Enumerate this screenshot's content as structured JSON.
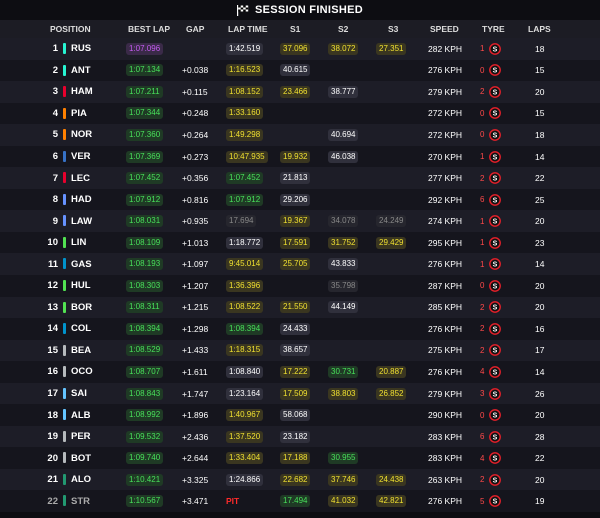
{
  "title": "SESSION FINISHED",
  "headers": {
    "position": "POSITION",
    "best_lap": "BEST LAP",
    "gap": "GAP",
    "lap_time": "LAP TIME",
    "s1": "S1",
    "s2": "S2",
    "s3": "S3",
    "speed": "SPEED",
    "tyre": "TYRE",
    "laps": "LAPS"
  },
  "colors": {
    "purple": "#c45cf0",
    "green": "#48e05a",
    "yellow": "#f0e030",
    "red": "#ff2a2a"
  },
  "rows": [
    {
      "pos": "1",
      "code": "RUS",
      "team_color": "#27f4d2",
      "best": "1:07.096",
      "best_c": "purple",
      "gap": "",
      "lap": "1:42.519",
      "lap_c": "white",
      "s1": "37.096",
      "s1_c": "yellow",
      "s2": "38.072",
      "s2_c": "yellow",
      "s3": "27.351",
      "s3_c": "yellow",
      "speed": "282 KPH",
      "tyre_laps": "1",
      "laps": "18"
    },
    {
      "pos": "2",
      "code": "ANT",
      "team_color": "#27f4d2",
      "best": "1:07.134",
      "best_c": "green",
      "gap": "+0.038",
      "lap": "1:16.523",
      "lap_c": "yellow",
      "s1": "40.615",
      "s1_c": "white",
      "s2": "",
      "s2_c": "none",
      "s3": "",
      "s3_c": "none",
      "speed": "276 KPH",
      "tyre_laps": "0",
      "laps": "15"
    },
    {
      "pos": "3",
      "code": "HAM",
      "team_color": "#e8002d",
      "best": "1:07.211",
      "best_c": "green",
      "gap": "+0.115",
      "lap": "1:08.152",
      "lap_c": "yellow",
      "s1": "23.466",
      "s1_c": "yellow",
      "s2": "38.777",
      "s2_c": "white",
      "s3": "",
      "s3_c": "none",
      "speed": "279 KPH",
      "tyre_laps": "2",
      "laps": "20"
    },
    {
      "pos": "4",
      "code": "PIA",
      "team_color": "#ff8000",
      "best": "1:07.344",
      "best_c": "green",
      "gap": "+0.248",
      "lap": "1:33.160",
      "lap_c": "yellow",
      "s1": "",
      "s1_c": "none",
      "s2": "",
      "s2_c": "none",
      "s3": "",
      "s3_c": "none",
      "speed": "272 KPH",
      "tyre_laps": "0",
      "laps": "15"
    },
    {
      "pos": "5",
      "code": "NOR",
      "team_color": "#ff8000",
      "best": "1:07.360",
      "best_c": "green",
      "gap": "+0.264",
      "lap": "1:49.298",
      "lap_c": "yellow",
      "s1": "",
      "s1_c": "none",
      "s2": "40.694",
      "s2_c": "white",
      "s3": "",
      "s3_c": "none",
      "speed": "272 KPH",
      "tyre_laps": "0",
      "laps": "18"
    },
    {
      "pos": "6",
      "code": "VER",
      "team_color": "#3671c6",
      "best": "1:07.369",
      "best_c": "green",
      "gap": "+0.273",
      "lap": "10:47.935",
      "lap_c": "yellow",
      "s1": "19.932",
      "s1_c": "yellow",
      "s2": "46.038",
      "s2_c": "white",
      "s3": "",
      "s3_c": "none",
      "speed": "270 KPH",
      "tyre_laps": "1",
      "laps": "14"
    },
    {
      "pos": "7",
      "code": "LEC",
      "team_color": "#e8002d",
      "best": "1:07.452",
      "best_c": "green",
      "gap": "+0.356",
      "lap": "1:07.452",
      "lap_c": "green",
      "s1": "21.813",
      "s1_c": "white",
      "s2": "",
      "s2_c": "none",
      "s3": "",
      "s3_c": "none",
      "speed": "277 KPH",
      "tyre_laps": "2",
      "laps": "22"
    },
    {
      "pos": "8",
      "code": "HAD",
      "team_color": "#6692ff",
      "best": "1:07.912",
      "best_c": "green",
      "gap": "+0.816",
      "lap": "1:07.912",
      "lap_c": "green",
      "s1": "29.206",
      "s1_c": "white",
      "s2": "",
      "s2_c": "none",
      "s3": "",
      "s3_c": "none",
      "speed": "292 KPH",
      "tyre_laps": "6",
      "laps": "25"
    },
    {
      "pos": "9",
      "code": "LAW",
      "team_color": "#6692ff",
      "best": "1:08.031",
      "best_c": "green",
      "gap": "+0.935",
      "lap": "17.694",
      "lap_c": "grey",
      "s1": "19.367",
      "s1_c": "yellow",
      "s2": "34.078",
      "s2_c": "grey",
      "s3": "24.249",
      "s3_c": "grey",
      "speed": "274 KPH",
      "tyre_laps": "1",
      "laps": "20"
    },
    {
      "pos": "10",
      "code": "LIN",
      "team_color": "#52e252",
      "best": "1:08.109",
      "best_c": "green",
      "gap": "+1.013",
      "lap": "1:18.772",
      "lap_c": "white",
      "s1": "17.591",
      "s1_c": "yellow",
      "s2": "31.752",
      "s2_c": "yellow",
      "s3": "29.429",
      "s3_c": "yellow",
      "speed": "295 KPH",
      "tyre_laps": "1",
      "laps": "23"
    },
    {
      "pos": "11",
      "code": "GAS",
      "team_color": "#0093cc",
      "best": "1:08.193",
      "best_c": "green",
      "gap": "+1.097",
      "lap": "9:45.014",
      "lap_c": "yellow",
      "s1": "25.705",
      "s1_c": "yellow",
      "s2": "43.833",
      "s2_c": "white",
      "s3": "",
      "s3_c": "none",
      "speed": "276 KPH",
      "tyre_laps": "1",
      "laps": "14"
    },
    {
      "pos": "12",
      "code": "HUL",
      "team_color": "#52e252",
      "best": "1:08.303",
      "best_c": "green",
      "gap": "+1.207",
      "lap": "1:36.396",
      "lap_c": "yellow",
      "s1": "",
      "s1_c": "none",
      "s2": "35.798",
      "s2_c": "grey",
      "s3": "",
      "s3_c": "none",
      "speed": "287 KPH",
      "tyre_laps": "0",
      "laps": "20"
    },
    {
      "pos": "13",
      "code": "BOR",
      "team_color": "#52e252",
      "best": "1:08.311",
      "best_c": "green",
      "gap": "+1.215",
      "lap": "1:08.522",
      "lap_c": "yellow",
      "s1": "21.550",
      "s1_c": "yellow",
      "s2": "44.149",
      "s2_c": "white",
      "s3": "",
      "s3_c": "none",
      "speed": "285 KPH",
      "tyre_laps": "2",
      "laps": "20"
    },
    {
      "pos": "14",
      "code": "COL",
      "team_color": "#0093cc",
      "best": "1:08.394",
      "best_c": "green",
      "gap": "+1.298",
      "lap": "1:08.394",
      "lap_c": "green",
      "s1": "24.433",
      "s1_c": "white",
      "s2": "",
      "s2_c": "none",
      "s3": "",
      "s3_c": "none",
      "speed": "276 KPH",
      "tyre_laps": "2",
      "laps": "16"
    },
    {
      "pos": "15",
      "code": "BEA",
      "team_color": "#b6babd",
      "best": "1:08.529",
      "best_c": "green",
      "gap": "+1.433",
      "lap": "1:18.315",
      "lap_c": "yellow",
      "s1": "38.657",
      "s1_c": "white",
      "s2": "",
      "s2_c": "none",
      "s3": "",
      "s3_c": "none",
      "speed": "275 KPH",
      "tyre_laps": "2",
      "laps": "17"
    },
    {
      "pos": "16",
      "code": "OCO",
      "team_color": "#b6babd",
      "best": "1:08.707",
      "best_c": "green",
      "gap": "+1.611",
      "lap": "1:08.840",
      "lap_c": "white",
      "s1": "17.222",
      "s1_c": "yellow",
      "s2": "30.731",
      "s2_c": "green",
      "s3": "20.887",
      "s3_c": "yellow",
      "speed": "276 KPH",
      "tyre_laps": "4",
      "laps": "14"
    },
    {
      "pos": "17",
      "code": "SAI",
      "team_color": "#64c4ff",
      "best": "1:08.843",
      "best_c": "green",
      "gap": "+1.747",
      "lap": "1:23.164",
      "lap_c": "white",
      "s1": "17.509",
      "s1_c": "yellow",
      "s2": "38.803",
      "s2_c": "yellow",
      "s3": "26.852",
      "s3_c": "yellow",
      "speed": "279 KPH",
      "tyre_laps": "3",
      "laps": "26"
    },
    {
      "pos": "18",
      "code": "ALB",
      "team_color": "#64c4ff",
      "best": "1:08.992",
      "best_c": "green",
      "gap": "+1.896",
      "lap": "1:40.967",
      "lap_c": "yellow",
      "s1": "58.068",
      "s1_c": "white",
      "s2": "",
      "s2_c": "none",
      "s3": "",
      "s3_c": "none",
      "speed": "290 KPH",
      "tyre_laps": "0",
      "laps": "20"
    },
    {
      "pos": "19",
      "code": "PER",
      "team_color": "#b6babd",
      "best": "1:09.532",
      "best_c": "green",
      "gap": "+2.436",
      "lap": "1:37.520",
      "lap_c": "yellow",
      "s1": "23.182",
      "s1_c": "white",
      "s2": "",
      "s2_c": "none",
      "s3": "",
      "s3_c": "none",
      "speed": "283 KPH",
      "tyre_laps": "6",
      "laps": "28"
    },
    {
      "pos": "20",
      "code": "BOT",
      "team_color": "#b6babd",
      "best": "1:09.740",
      "best_c": "green",
      "gap": "+2.644",
      "lap": "1:33.404",
      "lap_c": "yellow",
      "s1": "17.188",
      "s1_c": "yellow",
      "s2": "30.955",
      "s2_c": "green",
      "s3": "",
      "s3_c": "none",
      "speed": "283 KPH",
      "tyre_laps": "4",
      "laps": "22"
    },
    {
      "pos": "21",
      "code": "ALO",
      "team_color": "#229971",
      "best": "1:10.421",
      "best_c": "green",
      "gap": "+3.325",
      "lap": "1:24.866",
      "lap_c": "white",
      "s1": "22.682",
      "s1_c": "yellow",
      "s2": "37.746",
      "s2_c": "yellow",
      "s3": "24.438",
      "s3_c": "yellow",
      "speed": "263 KPH",
      "tyre_laps": "2",
      "laps": "20"
    },
    {
      "pos": "22",
      "code": "STR",
      "team_color": "#229971",
      "best": "1:10.567",
      "best_c": "green",
      "gap": "+3.471",
      "lap": "PIT",
      "lap_c": "pit",
      "s1": "17.494",
      "s1_c": "green",
      "s2": "41.032",
      "s2_c": "yellow",
      "s3": "42.821",
      "s3_c": "yellow",
      "speed": "276 KPH",
      "tyre_laps": "5",
      "laps": "19"
    }
  ]
}
